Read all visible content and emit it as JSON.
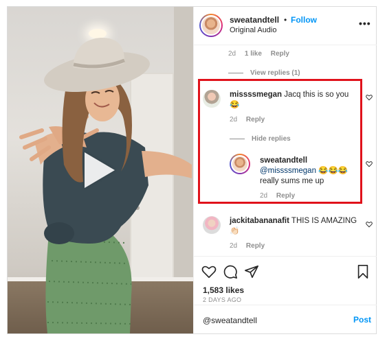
{
  "header": {
    "username": "sweatandtell",
    "separator": "•",
    "follow_label": "Follow",
    "subtitle": "Original Audio",
    "more_label": "•••"
  },
  "comments": {
    "prev_meta": {
      "time": "2d",
      "likes": "1 like",
      "reply": "Reply"
    },
    "prev_view_replies": "View replies (1)",
    "c1": {
      "username": "missssmegan",
      "text": "Jacq this is so you",
      "emoji": "😂",
      "time": "2d",
      "reply": "Reply",
      "hide_replies": "Hide replies"
    },
    "r1": {
      "username": "sweatandtell",
      "mention": "@missssmegan",
      "emoji": "😂😂😂",
      "text": "really sums me up",
      "time": "2d",
      "reply": "Reply"
    },
    "c2": {
      "username": "jackitabananafit",
      "text": "THIS IS AMAZING",
      "emoji": "👏🏻",
      "time": "2d",
      "reply": "Reply"
    }
  },
  "actions": {
    "icons": [
      "heart-icon",
      "comment-icon",
      "share-icon",
      "bookmark-icon"
    ],
    "likes": "1,583 likes",
    "date": "2 DAYS AGO"
  },
  "add_comment": {
    "value": "@sweatandtell",
    "post_label": "Post"
  },
  "colors": {
    "accent": "#0095f6",
    "highlight_border": "#e0121b",
    "muted_text": "#8e8e8e"
  }
}
